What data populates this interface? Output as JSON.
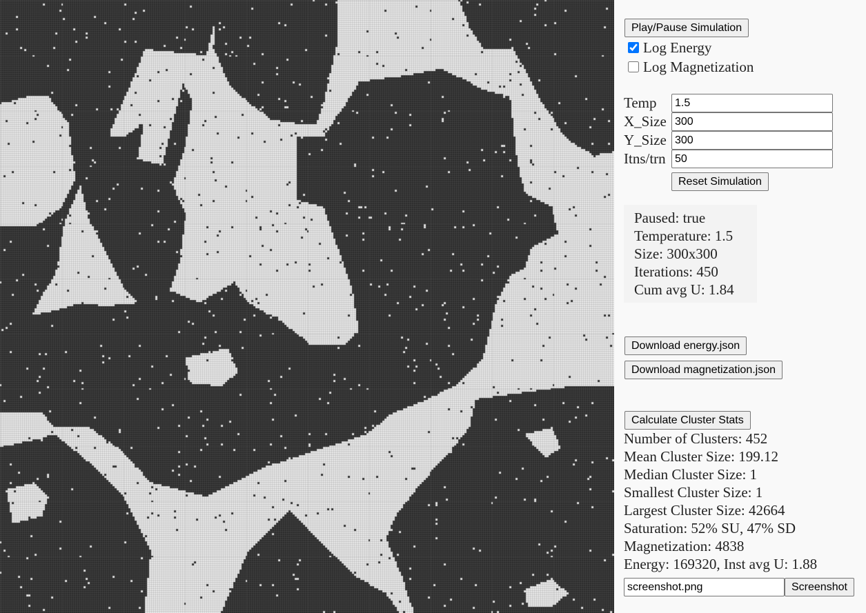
{
  "controls": {
    "play_pause_label": "Play/Pause Simulation",
    "log_energy": {
      "label": "Log Energy",
      "checked": true
    },
    "log_magnetization": {
      "label": "Log Magnetization",
      "checked": false
    }
  },
  "params": {
    "temp": {
      "label": "Temp",
      "value": "1.5"
    },
    "x_size": {
      "label": "X_Size",
      "value": "300"
    },
    "y_size": {
      "label": "Y_Size",
      "value": "300"
    },
    "itns": {
      "label": "Itns/trn",
      "value": "50"
    },
    "reset_label": "Reset Simulation"
  },
  "status": {
    "paused": "Paused: true",
    "temperature": "Temperature: 1.5",
    "size": "Size: 300x300",
    "iterations": "Iterations: 450",
    "cum_avg_u": "Cum avg U: 1.84"
  },
  "downloads": {
    "energy_label": "Download energy.json",
    "magnetization_label": "Download magnetization.json"
  },
  "clusters": {
    "button_label": "Calculate Cluster Stats",
    "number": "Number of Clusters: 452",
    "mean": "Mean Cluster Size: 199.12",
    "median": "Median Cluster Size: 1",
    "smallest": "Smallest Cluster Size: 1",
    "largest": "Largest Cluster Size: 42664",
    "saturation": "Saturation: 52% SU, 47% SD",
    "magnetization": "Magnetization: 4838",
    "energy": "Energy: 169320, Inst avg U: 1.88"
  },
  "screenshot": {
    "filename": "screenshot.png",
    "button_label": "Screenshot"
  },
  "lattice": {
    "spin_up_color": "#e8e8e8",
    "spin_down_color": "#2b2b2b",
    "grid_columns": 300,
    "grid_rows": 300
  }
}
